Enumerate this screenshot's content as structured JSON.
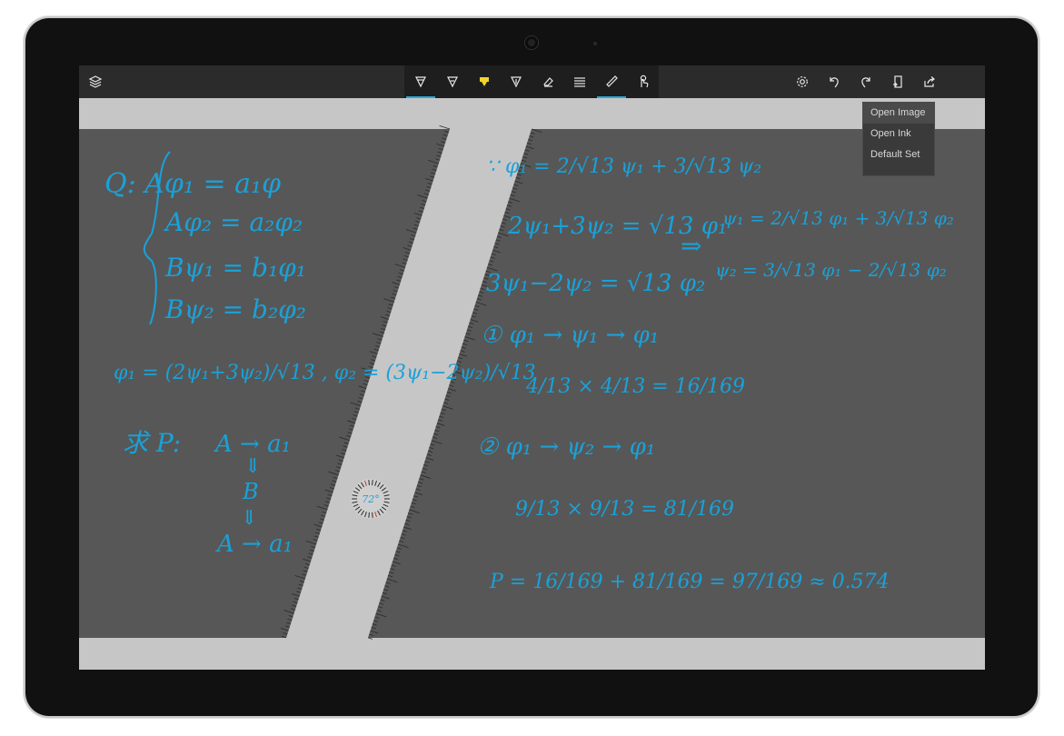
{
  "toolbar": {
    "left_icon": "layers-icon",
    "tools": [
      {
        "icon": "ballpoint-pen-icon",
        "active": true
      },
      {
        "icon": "pencil-icon",
        "active": false
      },
      {
        "icon": "highlighter-icon",
        "active": false
      },
      {
        "icon": "calligraphy-pen-icon",
        "active": false
      },
      {
        "icon": "eraser-icon",
        "active": false
      },
      {
        "icon": "lines-icon",
        "active": false
      },
      {
        "icon": "ruler-icon",
        "active": true
      },
      {
        "icon": "touch-writing-icon",
        "active": false
      }
    ],
    "right_icons": [
      "gear-icon",
      "undo-icon",
      "redo-icon",
      "open-file-icon",
      "share-icon"
    ]
  },
  "menu": {
    "items": [
      "Open Image",
      "Open Ink",
      "Default Set"
    ]
  },
  "ruler": {
    "angle": "72°"
  },
  "ink": {
    "lines_left": [
      "Q: Aφ₁ = a₁φ",
      "Aφ₂ = a₂φ₂",
      "Bψ₁ = b₁φ₁",
      "Bψ₂ = b₂φ₂",
      "φ₁ = (2ψ₁+3ψ₂)/√13 , φ₂ = (3ψ₁−2ψ₂)/√13",
      "求 P:",
      "A → a₁",
      "⇓",
      "B",
      "⇓",
      "A → a₁"
    ],
    "lines_right": [
      "∵ φ₁ = 2/√13 ψ₁ + 3/√13 ψ₂",
      "2ψ₁+3ψ₂ = √13 φ₁",
      "3ψ₁−2ψ₂ = √13 φ₂",
      "⇒",
      "ψ₁ = 2/√13 φ₁ + 3/√13 φ₂",
      "ψ₂ = 3/√13 φ₁ − 2/√13 φ₂",
      "① φ₁ → ψ₁ → φ₁",
      "4/13 × 4/13 = 16/169",
      "② φ₁ → ψ₂ → φ₁",
      "9/13 × 9/13 = 81/169",
      "P = 16/169 + 81/169 = 97/169 ≈ 0.574"
    ]
  },
  "colors": {
    "ink": "#1aa1d8",
    "accent": "#27a8d8",
    "canvas": "#575757",
    "ruler": "#c6c6c6"
  }
}
